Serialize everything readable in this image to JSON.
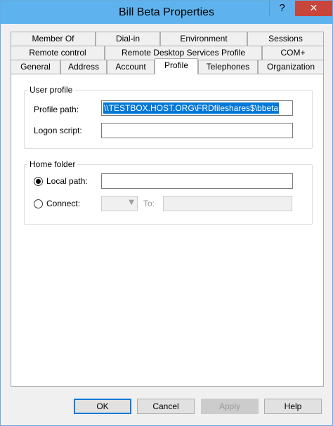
{
  "window": {
    "title": "Bill Beta Properties",
    "help_glyph": "?",
    "close_glyph": "✕"
  },
  "tabs": {
    "row1": [
      "Member Of",
      "Dial-in",
      "Environment",
      "Sessions"
    ],
    "row2": [
      "Remote control",
      "Remote Desktop Services Profile",
      "COM+"
    ],
    "row3": [
      "General",
      "Address",
      "Account",
      "Profile",
      "Telephones",
      "Organization"
    ],
    "active": "Profile"
  },
  "user_profile": {
    "title": "User profile",
    "profile_path_label": "Profile path:",
    "profile_path_value": "\\\\TESTBOX.HOST.ORG\\FRDfileshares$\\bbeta",
    "logon_script_label": "Logon script:",
    "logon_script_value": ""
  },
  "home_folder": {
    "title": "Home folder",
    "local_path_label": "Local path:",
    "local_path_value": "",
    "connect_label": "Connect:",
    "to_label": "To:",
    "selected_option": "Local path"
  },
  "buttons": {
    "ok": "OK",
    "cancel": "Cancel",
    "apply": "Apply",
    "help": "Help"
  },
  "colors": {
    "titlebar": "#5eb3ef",
    "close": "#c7453b",
    "selection": "#0078d7"
  }
}
